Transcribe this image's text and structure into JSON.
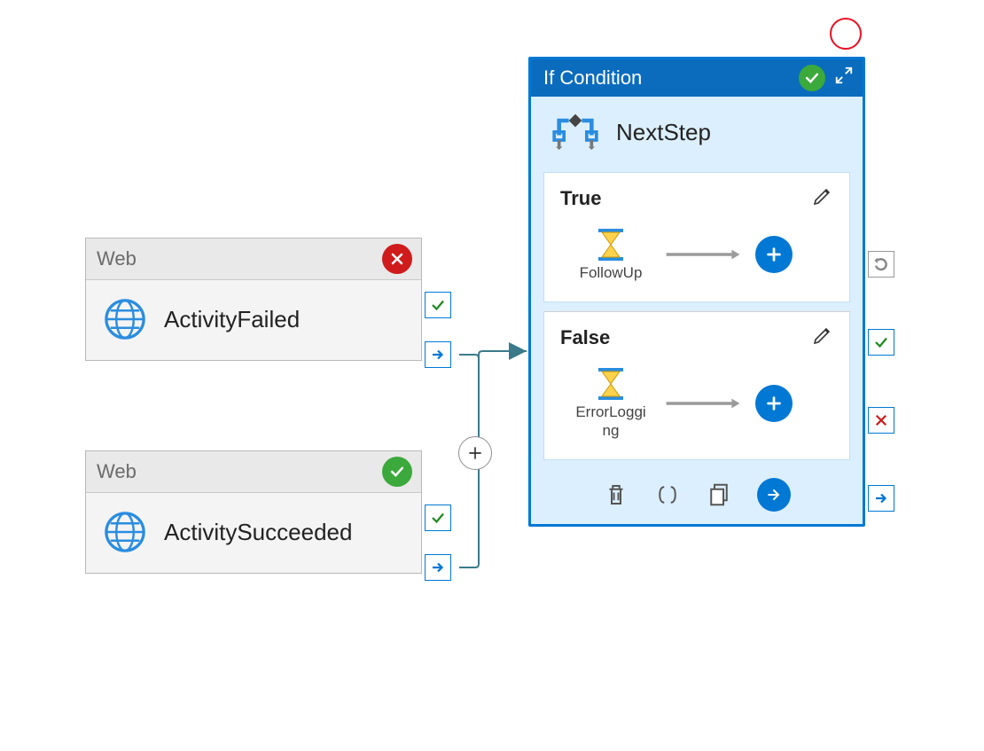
{
  "activities": {
    "a1": {
      "type": "Web",
      "name": "ActivityFailed",
      "status": "fail"
    },
    "a2": {
      "type": "Web",
      "name": "ActivitySucceeded",
      "status": "success"
    }
  },
  "ifPanel": {
    "header": "If Condition",
    "title": "NextStep",
    "status": "success",
    "branches": {
      "true": {
        "label": "True",
        "activityName": "FollowUp"
      },
      "false": {
        "label": "False",
        "activityName": "ErrorLogging"
      }
    }
  },
  "colors": {
    "primary": "#0078d4",
    "headerBlue": "#0b6cbe",
    "panelBg": "#dcefff",
    "green": "#3ba93b",
    "red": "#cf1b1b",
    "wire": "#3a7a8a"
  }
}
